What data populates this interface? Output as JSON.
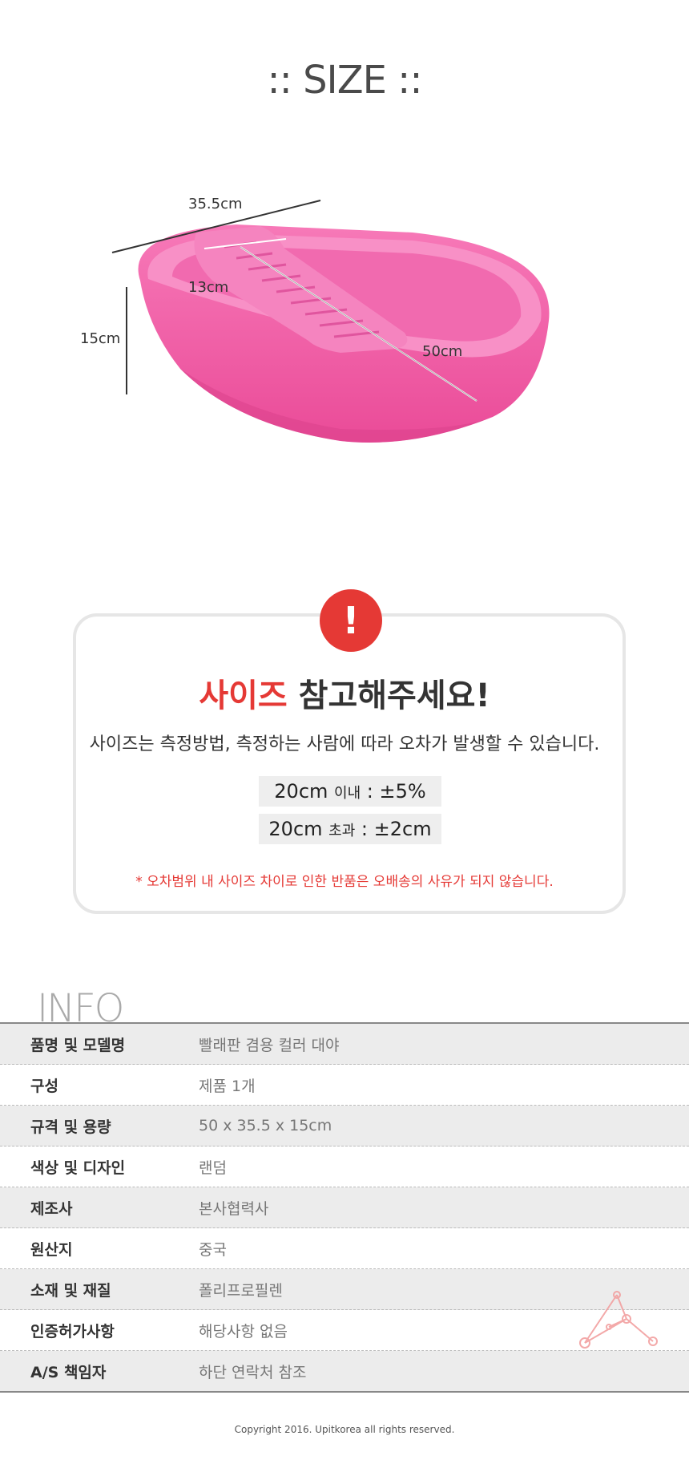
{
  "size_title": ":: SIZE ::",
  "dimensions": {
    "length": "35.5cm",
    "width": "13cm",
    "height": "15cm",
    "board": "50cm"
  },
  "notice": {
    "title_red": "사이즈",
    "title_rest": " 참고해주세요!",
    "description": "사이즈는 측정방법, 측정하는 사람에 따라 오차가 발생할 수 있습니다.",
    "tolerance": [
      {
        "size": "20cm",
        "cond": "이내",
        "value": " : ±5%"
      },
      {
        "size": "20cm",
        "cond": "초과",
        "value": " : ±2cm"
      }
    ],
    "warning": "* 오차범위 내 사이즈 차이로 인한 반품은 오배송의 사유가 되지 않습니다."
  },
  "info": {
    "heading": "INFO",
    "rows": [
      {
        "key": "품명 및 모델명",
        "value": "빨래판 겸용 컬러 대야"
      },
      {
        "key": "구성",
        "value": "제품 1개"
      },
      {
        "key": "규격 및 용량",
        "value": "50 x 35.5 x 15cm"
      },
      {
        "key": "색상 및 디자인",
        "value": "랜덤"
      },
      {
        "key": "제조사",
        "value": "본사협력사"
      },
      {
        "key": "원산지",
        "value": "중국"
      },
      {
        "key": "소재 및 재질",
        "value": "폴리프로필렌"
      },
      {
        "key": "인증허가사항",
        "value": "해당사항  없음"
      },
      {
        "key": "A/S 책임자",
        "value": "하단 연락처 참조"
      }
    ]
  },
  "footer": "Copyright 2016. Upitkorea all rights reserved.",
  "colors": {
    "accent": "#e53935",
    "product": "#f25aa5"
  }
}
